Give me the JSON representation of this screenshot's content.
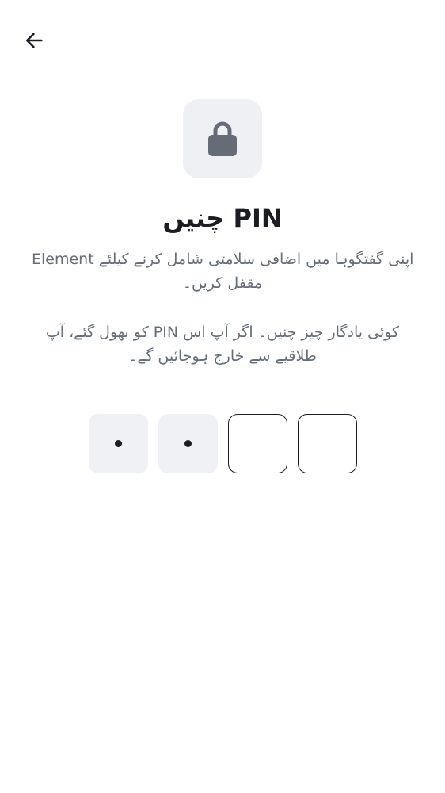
{
  "header": {
    "back_icon": "arrow-left-icon"
  },
  "hero": {
    "icon": "lock-icon"
  },
  "title": "چنیں PIN",
  "description": {
    "line1a": "Element اپنی گفتگوہا میں اضافی سلامتی شامل کرنے کیلئے",
    "line1b": "مقفل کریں۔",
    "line2a": "کو بھول گئے، آپ PIN کوئی یادگار چیز چنیں۔ اگر آپ اس",
    "line2b": "طلاقیے سے خارج ہوجائیں گے۔"
  },
  "pin": {
    "length": 4,
    "entered": 2,
    "boxes": [
      {
        "state": "filled"
      },
      {
        "state": "filled"
      },
      {
        "state": "empty"
      },
      {
        "state": "empty"
      }
    ]
  },
  "colors": {
    "text_primary": "#1b1d22",
    "text_secondary": "#656d77",
    "tile_bg": "#eef0f4",
    "lock_fill": "#656c76"
  }
}
